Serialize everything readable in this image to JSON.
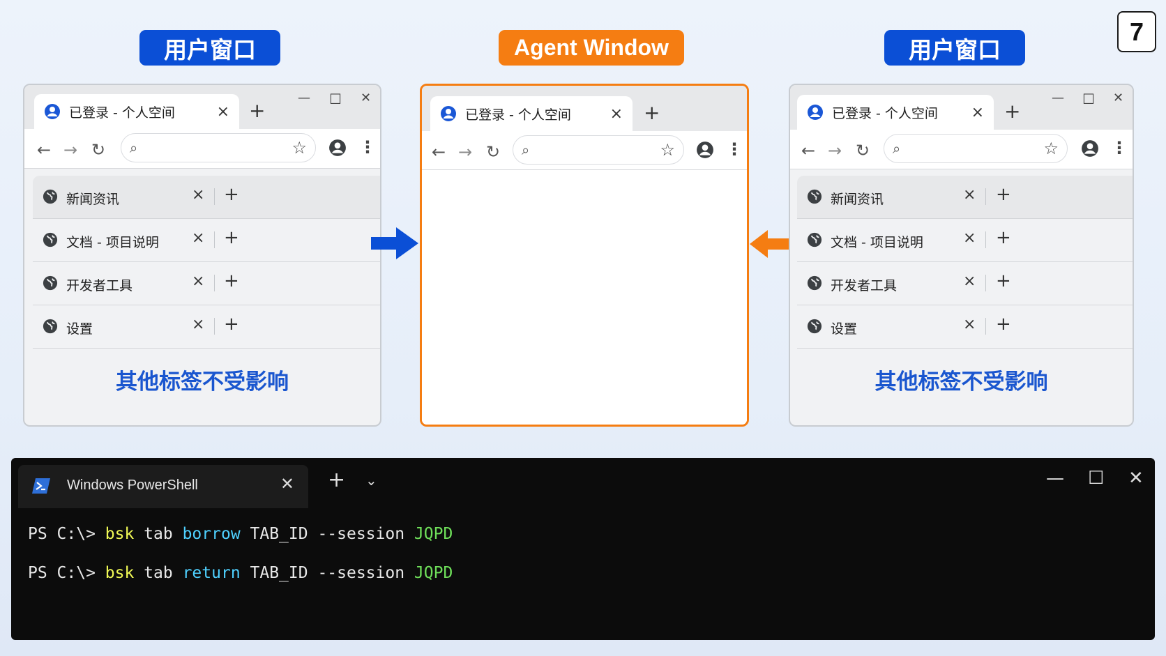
{
  "labels": {
    "left": "用户窗口",
    "center": "Agent Window",
    "right": "用户窗口"
  },
  "slide_number": "7",
  "browser": {
    "tab_title": "已登录 - 个人空间",
    "tab_close": "×",
    "new_tab": "+",
    "window_controls": {
      "minimize": "—",
      "maximize": "☐",
      "close": "✕"
    },
    "nav": {
      "back": "←",
      "forward": "→",
      "reload": "↻",
      "search": "⌕",
      "star": "☆",
      "menu": "⋮"
    }
  },
  "tab_rows": [
    {
      "label": "新闻资讯"
    },
    {
      "label": "文档 - 项目说明"
    },
    {
      "label": "开发者工具"
    },
    {
      "label": "设置"
    }
  ],
  "row_controls": {
    "close": "×",
    "add": "+"
  },
  "note": "其他标签不受影响",
  "colors": {
    "accent_blue": "#0b4fd6",
    "accent_orange": "#f57d12",
    "note_blue": "#1a56cf",
    "term_bg": "#0c0c0c"
  },
  "terminal": {
    "tab_title": "Windows PowerShell",
    "tab_close": "✕",
    "new_tab": "+",
    "dropdown": "⌄",
    "controls": {
      "minimize": "—",
      "maximize": "☐",
      "close": "✕"
    },
    "lines": [
      {
        "prompt": "PS C:\\> ",
        "cmd": "bsk",
        "t1": " tab ",
        "verb": "borrow",
        "t2": " TAB_ID --session ",
        "arg": "JQPD"
      },
      {
        "prompt": "PS C:\\> ",
        "cmd": "bsk",
        "t1": " tab ",
        "verb": "return",
        "t2": " TAB_ID --session ",
        "arg": "JQPD"
      }
    ]
  }
}
